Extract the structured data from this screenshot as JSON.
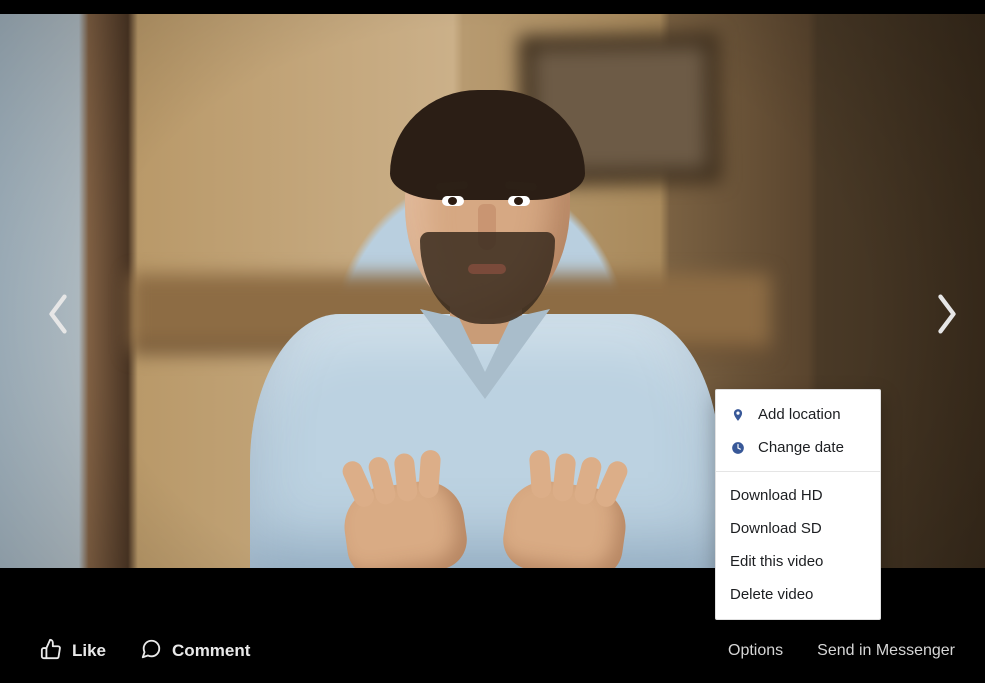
{
  "actions": {
    "like": "Like",
    "comment": "Comment",
    "options": "Options",
    "send_in_messenger": "Send in Messenger"
  },
  "options_menu": {
    "add_location": "Add location",
    "change_date": "Change date",
    "download_hd": "Download HD",
    "download_sd": "Download SD",
    "edit_video": "Edit this video",
    "delete_video": "Delete video"
  }
}
